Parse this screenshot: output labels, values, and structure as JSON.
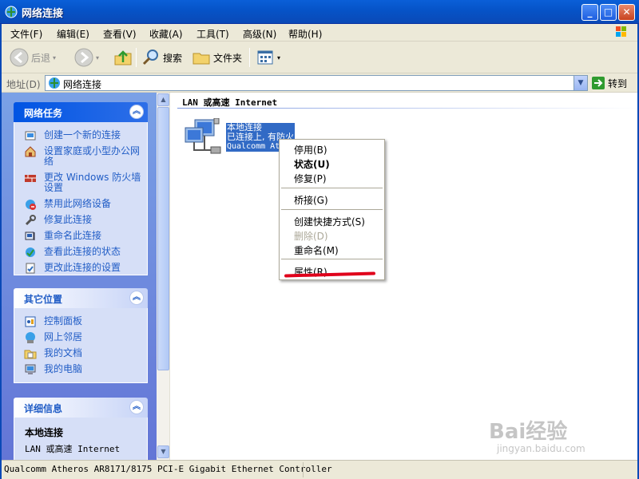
{
  "window": {
    "title": "网络连接"
  },
  "menu": [
    "文件(F)",
    "编辑(E)",
    "查看(V)",
    "收藏(A)",
    "工具(T)",
    "高级(N)",
    "帮助(H)"
  ],
  "toolbar": {
    "back": "后退",
    "search": "搜索",
    "folders": "文件夹"
  },
  "address": {
    "label": "地址(D)",
    "value": "网络连接",
    "go": "转到"
  },
  "tasks": {
    "title": "网络任务",
    "items": [
      {
        "label": "创建一个新的连接",
        "icon": "new-connection-icon"
      },
      {
        "label": "设置家庭或小型办公网络",
        "icon": "home-network-icon"
      },
      {
        "label": "更改 Windows 防火墙设置",
        "icon": "firewall-icon"
      },
      {
        "label": "禁用此网络设备",
        "icon": "disable-device-icon"
      },
      {
        "label": "修复此连接",
        "icon": "repair-icon"
      },
      {
        "label": "重命名此连接",
        "icon": "rename-icon"
      },
      {
        "label": "查看此连接的状态",
        "icon": "status-icon"
      },
      {
        "label": "更改此连接的设置",
        "icon": "settings-icon"
      }
    ]
  },
  "places": {
    "title": "其它位置",
    "items": [
      {
        "label": "控制面板",
        "icon": "control-panel-icon"
      },
      {
        "label": "网上邻居",
        "icon": "network-places-icon"
      },
      {
        "label": "我的文档",
        "icon": "my-documents-icon"
      },
      {
        "label": "我的电脑",
        "icon": "my-computer-icon"
      }
    ]
  },
  "details": {
    "title": "详细信息",
    "name": "本地连接",
    "type": "LAN 或高速 Internet"
  },
  "group": {
    "header": "LAN 或高速 Internet"
  },
  "connection": {
    "name": "本地连接",
    "status": "已连接上, 有防火",
    "adapter": "Qualcomm At"
  },
  "context_menu": {
    "items": [
      {
        "label": "停用(B)",
        "style": "normal"
      },
      {
        "label": "状态(U)",
        "style": "bold"
      },
      {
        "label": "修复(P)",
        "style": "normal"
      },
      {
        "label": "桥接(G)",
        "style": "normal"
      },
      {
        "label": "创建快捷方式(S)",
        "style": "normal"
      },
      {
        "label": "删除(D)",
        "style": "disabled"
      },
      {
        "label": "重命名(M)",
        "style": "normal"
      },
      {
        "label": "属性(R)",
        "style": "normal"
      }
    ]
  },
  "status_bar": {
    "text": "Qualcomm Atheros AR8171/8175 PCI-E Gigabit Ethernet Controller"
  },
  "watermark": {
    "brand": "Bai经验",
    "url": "jingyan.baidu.com"
  },
  "colors": {
    "titlebar": "#0a5fd8",
    "selection": "#316ac5",
    "link": "#215dc6",
    "annotation": "#e0001a"
  }
}
